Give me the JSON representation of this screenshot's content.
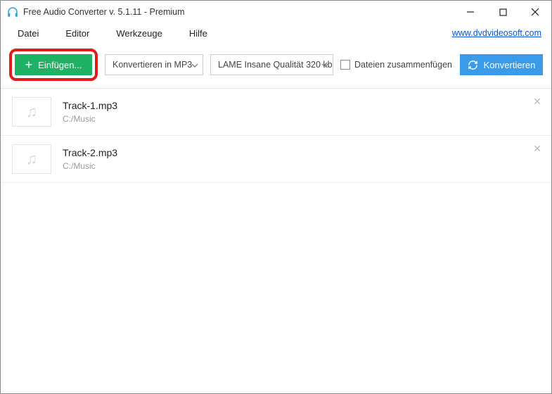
{
  "window": {
    "title": "Free Audio Converter v. 5.1.11 - Premium"
  },
  "menu": {
    "items": [
      "Datei",
      "Editor",
      "Werkzeuge",
      "Hilfe"
    ],
    "link": "www.dvdvideosoft.com"
  },
  "toolbar": {
    "add_label": "Einfügen...",
    "format_selected": "Konvertieren in MP3",
    "quality_selected": "LAME Insane Qualität 320 kb",
    "merge_label": "Dateien zusammenfügen",
    "merge_checked": false,
    "convert_label": "Konvertieren"
  },
  "tracks": [
    {
      "name": "Track-1.mp3",
      "path": "C:/Music"
    },
    {
      "name": "Track-2.mp3",
      "path": "C:/Music"
    }
  ]
}
